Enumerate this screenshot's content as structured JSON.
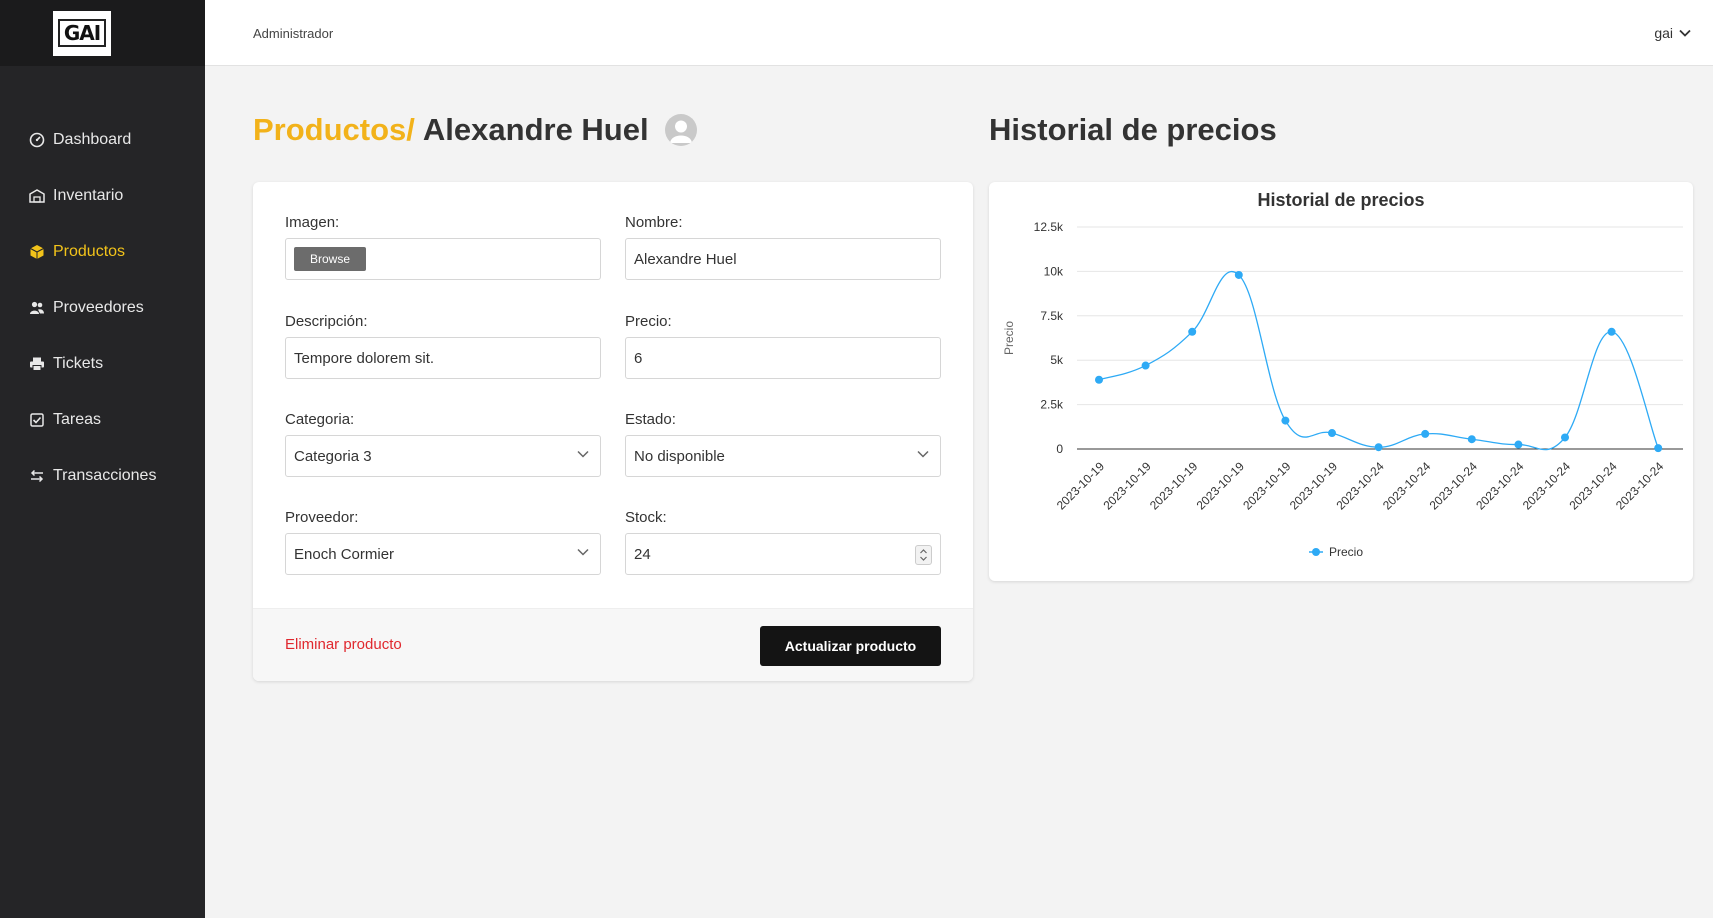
{
  "app": {
    "logo_text": "GAI"
  },
  "topbar": {
    "role": "Administrador",
    "user": "gai"
  },
  "sidebar": {
    "items": [
      {
        "label": "Dashboard",
        "icon": "dashboard-icon"
      },
      {
        "label": "Inventario",
        "icon": "warehouse-icon"
      },
      {
        "label": "Productos",
        "icon": "box-icon",
        "active": true
      },
      {
        "label": "Proveedores",
        "icon": "users-icon"
      },
      {
        "label": "Tickets",
        "icon": "printer-icon"
      },
      {
        "label": "Tareas",
        "icon": "checkbox-icon"
      },
      {
        "label": "Transacciones",
        "icon": "transfer-icon"
      }
    ]
  },
  "header": {
    "breadcrumb_link": "Productos/",
    "product_name": "Alexandre Huel",
    "history_title": "Historial de precios"
  },
  "form": {
    "image": {
      "label": "Imagen:",
      "button": "Browse"
    },
    "name": {
      "label": "Nombre:",
      "value": "Alexandre Huel"
    },
    "description": {
      "label": "Descripción:",
      "value": "Tempore dolorem sit."
    },
    "price": {
      "label": "Precio:",
      "value": "6"
    },
    "category": {
      "label": "Categoria:",
      "value": "Categoria 3"
    },
    "status": {
      "label": "Estado:",
      "value": "No disponible"
    },
    "provider": {
      "label": "Proveedor:",
      "value": "Enoch Cormier"
    },
    "stock": {
      "label": "Stock:",
      "value": "24"
    },
    "delete_label": "Eliminar producto",
    "update_label": "Actualizar producto"
  },
  "colors": {
    "accent": "#f2b21a",
    "sidebar_bg": "#252527",
    "danger": "#e0282e",
    "series": "#2eaaf5"
  },
  "chart_data": {
    "type": "line",
    "title": "Historial de precios",
    "xlabel": "",
    "ylabel": "Precio",
    "categories": [
      "2023-10-19",
      "2023-10-19",
      "2023-10-19",
      "2023-10-19",
      "2023-10-19",
      "2023-10-19",
      "2023-10-24",
      "2023-10-24",
      "2023-10-24",
      "2023-10-24",
      "2023-10-24",
      "2023-10-24",
      "2023-10-24"
    ],
    "series": [
      {
        "name": "Precio",
        "values": [
          3900,
          4700,
          6600,
          9800,
          1600,
          900,
          100,
          850,
          550,
          250,
          650,
          6600,
          50
        ]
      }
    ],
    "ylim": [
      0,
      12500
    ],
    "yticks": [
      0,
      2500,
      5000,
      7500,
      10000,
      12500
    ],
    "ytick_labels": [
      "0",
      "2.5k",
      "5k",
      "7.5k",
      "10k",
      "12.5k"
    ],
    "grid": true,
    "legend": "bottom"
  }
}
